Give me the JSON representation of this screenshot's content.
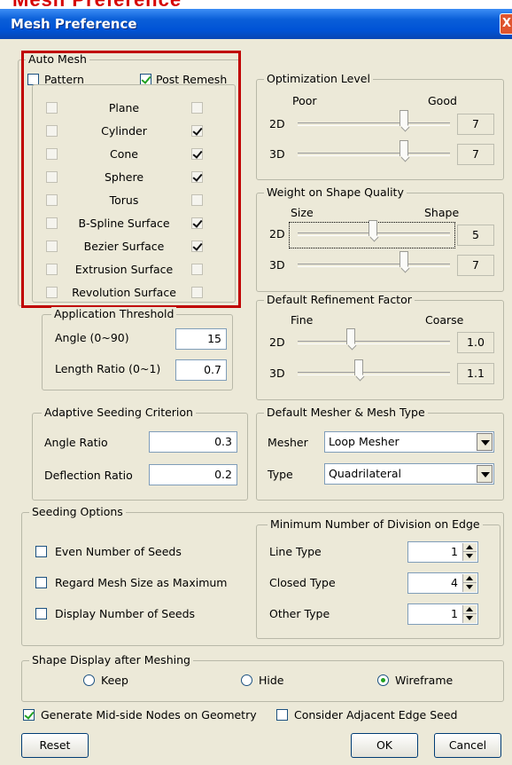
{
  "background_title": "Mesh Preference",
  "window": {
    "title": "Mesh Preference",
    "close_glyph": "X"
  },
  "auto_mesh": {
    "title": "Auto Mesh",
    "pattern_label": "Pattern",
    "post_remesh_label": "Post Remesh",
    "pattern_checked": false,
    "post_remesh_checked": true,
    "rows": [
      {
        "label": "Plane",
        "pattern": false,
        "post_remesh": false
      },
      {
        "label": "Cylinder",
        "pattern": false,
        "post_remesh": true
      },
      {
        "label": "Cone",
        "pattern": false,
        "post_remesh": true
      },
      {
        "label": "Sphere",
        "pattern": false,
        "post_remesh": true
      },
      {
        "label": "Torus",
        "pattern": false,
        "post_remesh": false
      },
      {
        "label": "B-Spline Surface",
        "pattern": false,
        "post_remesh": true
      },
      {
        "label": "Bezier Surface",
        "pattern": false,
        "post_remesh": true
      },
      {
        "label": "Extrusion Surface",
        "pattern": false,
        "post_remesh": false
      },
      {
        "label": "Revolution Surface",
        "pattern": false,
        "post_remesh": false
      }
    ],
    "highlight_color": "#c00000"
  },
  "application_threshold": {
    "title": "Application Threshold",
    "angle_label": "Angle (0~90)",
    "angle_value": "15",
    "length_label": "Length Ratio (0~1)",
    "length_value": "0.7"
  },
  "adaptive_seeding": {
    "title": "Adaptive Seeding Criterion",
    "angle_ratio_label": "Angle Ratio",
    "angle_ratio_value": "0.3",
    "deflection_label": "Deflection Ratio",
    "deflection_value": "0.2"
  },
  "optimization": {
    "title": "Optimization Level",
    "min_label": "Poor",
    "max_label": "Good",
    "rows": [
      {
        "label": "2D",
        "value": "7"
      },
      {
        "label": "3D",
        "value": "7"
      }
    ]
  },
  "weight": {
    "title": "Weight on Shape Quality",
    "min_label": "Size",
    "max_label": "Shape",
    "rows": [
      {
        "label": "2D",
        "value": "5"
      },
      {
        "label": "3D",
        "value": "7"
      }
    ]
  },
  "refinement": {
    "title": "Default Refinement Factor",
    "min_label": "Fine",
    "max_label": "Coarse",
    "rows": [
      {
        "label": "2D",
        "value": "1.0"
      },
      {
        "label": "3D",
        "value": "1.1"
      }
    ]
  },
  "mesher": {
    "title": "Default Mesher & Mesh Type",
    "mesher_label": "Mesher",
    "mesher_value": "Loop Mesher",
    "type_label": "Type",
    "type_value": "Quadrilateral"
  },
  "seeding": {
    "title": "Seeding Options",
    "options": [
      {
        "label": "Even Number of Seeds",
        "checked": false
      },
      {
        "label": "Regard Mesh Size as Maximum",
        "checked": false
      },
      {
        "label": "Display Number of Seeds",
        "checked": false
      }
    ]
  },
  "min_division": {
    "title": "Minimum Number of Division on Edge",
    "rows": [
      {
        "label": "Line Type",
        "value": "1"
      },
      {
        "label": "Closed Type",
        "value": "4"
      },
      {
        "label": "Other Type",
        "value": "1"
      }
    ]
  },
  "shape_display": {
    "title": "Shape Display after Meshing",
    "options": [
      {
        "label": "Keep",
        "checked": false
      },
      {
        "label": "Hide",
        "checked": false
      },
      {
        "label": "Wireframe",
        "checked": true
      }
    ]
  },
  "bottom": {
    "midside_label": "Generate Mid-side Nodes on Geometry",
    "midside_checked": true,
    "adjacent_label": "Consider Adjacent Edge Seed",
    "adjacent_checked": false,
    "reset_label": "Reset",
    "ok_label": "OK",
    "cancel_label": "Cancel"
  }
}
